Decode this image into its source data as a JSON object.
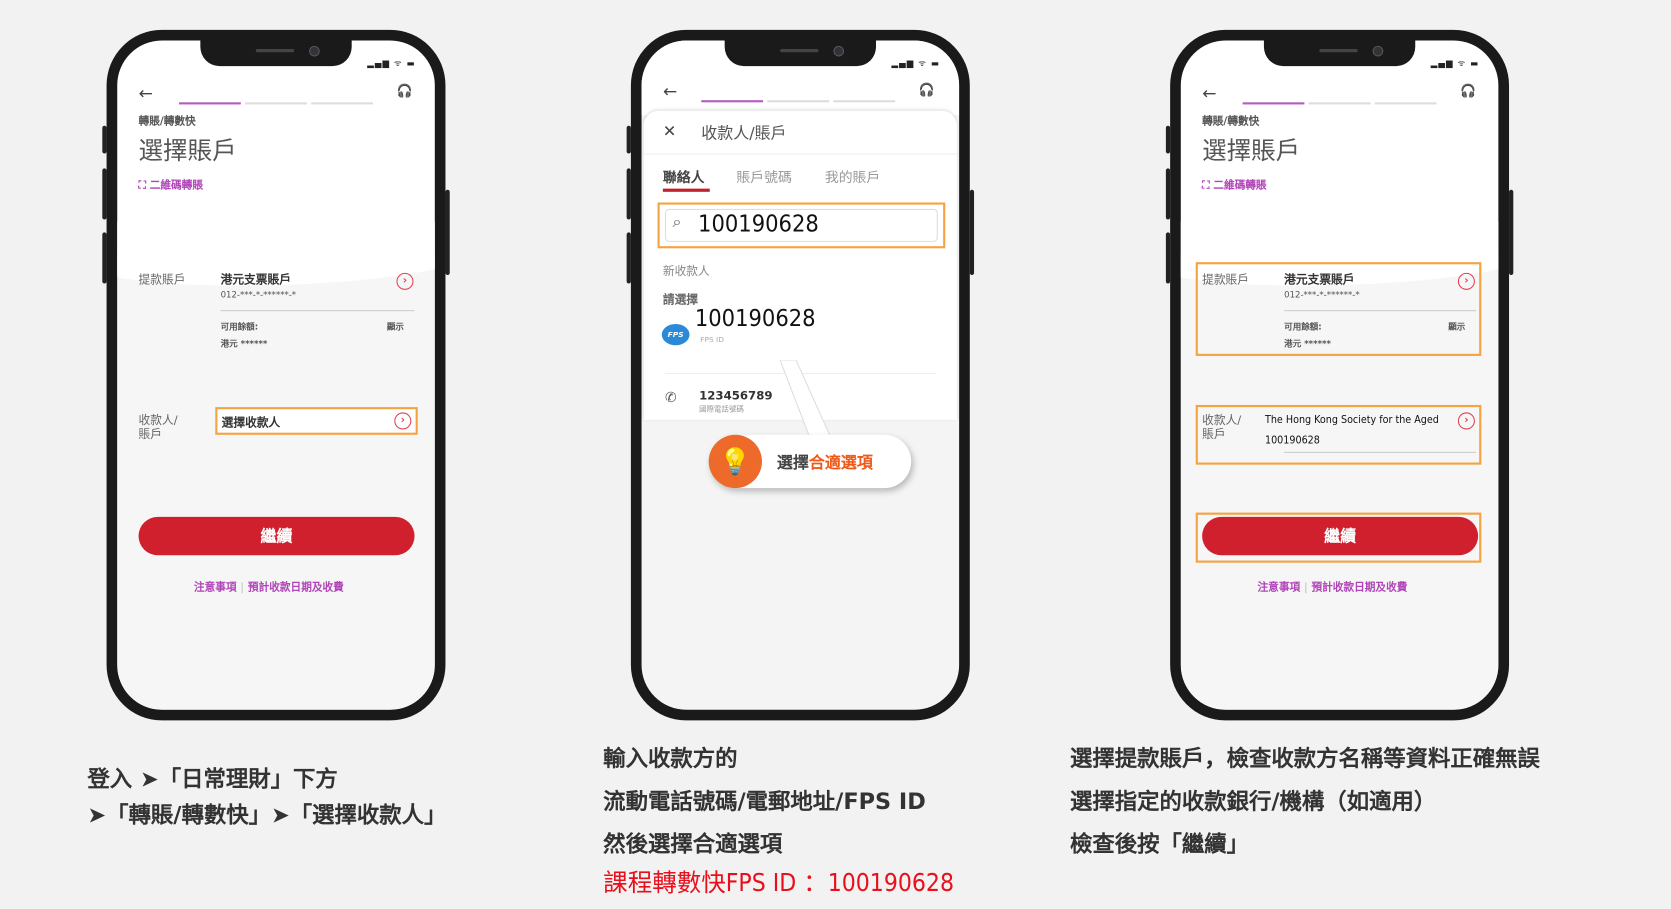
{
  "common": {
    "status_icons": "▂▄▆ ᯤ ▬",
    "back_icon": "←",
    "headset_icon": "🎧",
    "breadcrumb": "轉賬/轉數快",
    "title": "選擇賬戶",
    "qr_link": "二維碼轉賬",
    "debit_label": "提款賬戶",
    "account_name": "港元支票賬戶",
    "account_number": "012-***-*-******-*",
    "balance_label": "可用餘額:",
    "show_label": "顯示",
    "balance_value": "港元 ******",
    "payee_label": "收款人/\n賬戶",
    "continue": "繼續",
    "notes_link": "注意事項",
    "fee_link": "預計收款日期及收費",
    "chevron": "›",
    "accent": "#b044b8",
    "button_color": "#d0202e",
    "highlight_color": "#f4a340"
  },
  "phone1": {
    "payee_select": "選擇收款人"
  },
  "phone2": {
    "close_icon": "✕",
    "sheet_title": "收款人/賬戶",
    "tabs": [
      "聯絡人",
      "賬戶號碼",
      "我的賬戶"
    ],
    "active_tab": 0,
    "search_value": "100190628",
    "new_payee": "新收款人",
    "please_select": "請選擇",
    "fps_badge": "FPS",
    "option1_value": "100190628",
    "option1_sub": "FPS ID",
    "option2_value": "123456789",
    "option2_sub": "國際電話號碼",
    "tip_prefix": "選擇",
    "tip_highlight": "合適選項"
  },
  "phone3": {
    "payee_name": "The Hong Kong Society for the Aged",
    "payee_id": "100190628"
  },
  "captions": {
    "step1": [
      "登入 ➤「日常理財」下方",
      "➤「轉賬/轉數快」➤「選擇收款人」"
    ],
    "step2": [
      "輸入收款方的",
      "流動電話號碼/電郵地址/FPS ID",
      "然後選擇合適選項"
    ],
    "step2_note": "課程轉數快FPS ID ：100190628",
    "step3": [
      "選擇提款賬戶，檢查收款方名稱等資料正確無誤",
      "選擇指定的收款銀行/機構（如適用）",
      "檢查後按「繼續」"
    ]
  }
}
